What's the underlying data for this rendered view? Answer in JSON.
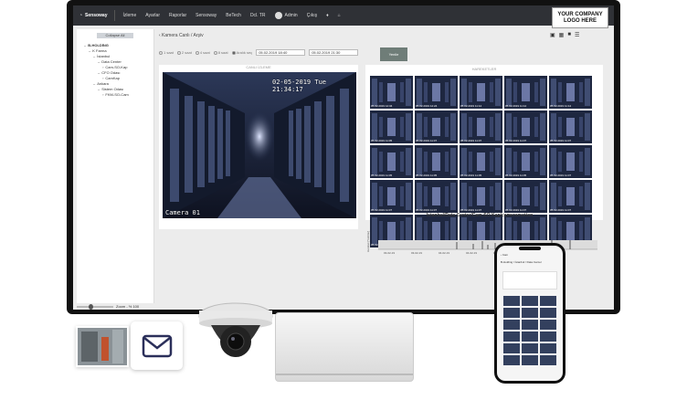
{
  "app": {
    "brand": "Sensoway",
    "nav": [
      "İzleme",
      "Ayarlar",
      "Raporlar",
      "Sensoway",
      "BeTech",
      "Dcl. TR"
    ],
    "user": "Admin",
    "logout": "Çıkış",
    "home_icon": "home-icon"
  },
  "logo": {
    "line1": "YOUR COMPANY",
    "line2": "LOGO HERE"
  },
  "sidebar": {
    "collapse": "Collapse All",
    "tree": [
      {
        "label": "B-HOLDİNG",
        "level": 0
      },
      {
        "label": "K Farma",
        "level": 1
      },
      {
        "label": "İstanbul",
        "level": 2
      },
      {
        "label": "Data Center",
        "level": 3
      },
      {
        "label": "Cam-SO-Kap",
        "level": 4
      },
      {
        "label": "CFO Odası",
        "level": 3
      },
      {
        "label": "CamKap",
        "level": 4
      },
      {
        "label": "Ankara",
        "level": 2
      },
      {
        "label": "Sistem Odası",
        "level": 3
      },
      {
        "label": "FKM-SO-Cam",
        "level": 4
      }
    ],
    "zoom": "Zoom - % 100"
  },
  "main": {
    "breadcrumb": "‹ Kamera Canlı / Arşiv",
    "filters": [
      "1 saat",
      "2 saat",
      "4 saat",
      "8 saat",
      "Aralık seç"
    ],
    "date_from": "05.02.2019 18:40",
    "date_to": "05.02.2019 21:30",
    "search_button": "Yenile",
    "live_title": "CANLI İZLEME",
    "motion_title": "HAREKETLER",
    "osd_datetime": "02-05-2019 Tue 21:34:17",
    "osd_camera": "Camera 01",
    "thumbs": [
      "05.02.2019 12:34",
      "05.02.2019 12:24",
      "05.02.2019 11:12",
      "05.02.2019 11:12",
      "05.02.2019 11:12",
      "05.02.2019 11:05",
      "05.02.2019 11:07",
      "05.02.2019 11:07",
      "05.02.2019 11:07",
      "05.02.2019 11:07",
      "05.02.2019 11:05",
      "05.02.2019 11:05",
      "05.02.2019 11:05",
      "05.02.2019 11:05",
      "05.02.2019 11:07",
      "05.02.2019 11:07",
      "05.02.2019 11:07",
      "05.02.2019 11:07",
      "05.02.2019 11:07",
      "05.02.2019 11:07",
      "05.02.2019 11:07",
      "05.02.2019 11:07",
      "05.02.2019 11:07",
      "05.02.2019 11:07",
      "05.02.2019 11:07"
    ],
    "chart_title": "İstanbul/Data Center/Cam-SO-Kap/cameramotion",
    "chart_ylabel": "Hareket [Yok/Var]"
  },
  "phone": {
    "header": "‹ Cam",
    "title": "B-Holding / İstanbul / Data Center"
  }
}
